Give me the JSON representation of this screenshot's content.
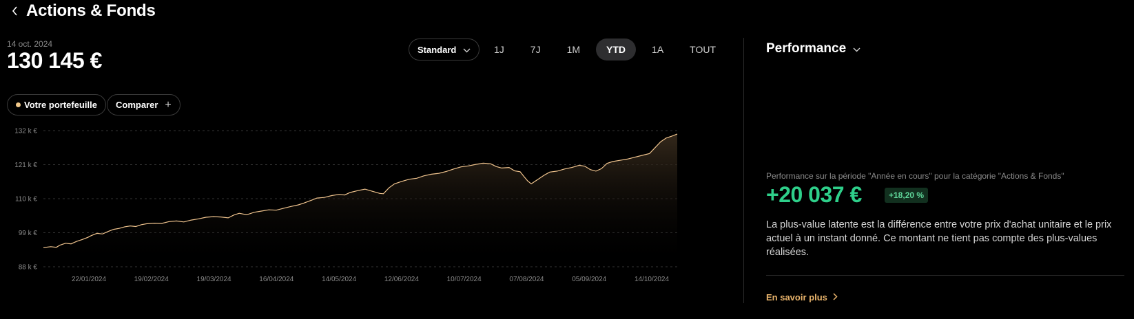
{
  "header": {
    "title": "Actions & Fonds",
    "back_icon": "chevron-left-icon"
  },
  "portfolio": {
    "date": "14 oct. 2024",
    "value": "130 145 €"
  },
  "pills": {
    "portfolio_label": "Votre portefeuille",
    "portfolio_dot_color": "#f2c98a",
    "compare_label": "Comparer",
    "compare_icon": "plus-icon"
  },
  "toolbar": {
    "standard_label": "Standard",
    "ranges": [
      "1J",
      "7J",
      "1M",
      "YTD",
      "1A",
      "TOUT"
    ],
    "active_range": "YTD"
  },
  "chart_data": {
    "type": "area",
    "series_color": "#f0c48e",
    "y_ticks": [
      "132 k €",
      "121 k €",
      "110 k €",
      "99 k €",
      "88 k €"
    ],
    "y_tick_values": [
      132,
      121,
      110,
      99,
      88
    ],
    "x_ticks": [
      "22/01/2024",
      "19/02/2024",
      "19/03/2024",
      "16/04/2024",
      "14/05/2024",
      "12/06/2024",
      "10/07/2024",
      "07/08/2024",
      "05/09/2024",
      "14/10/2024"
    ],
    "ylim": [
      88,
      132
    ],
    "grid": true,
    "points": [
      [
        0,
        94.2
      ],
      [
        4,
        94.5
      ],
      [
        7,
        94.3
      ],
      [
        9,
        95.0
      ],
      [
        12,
        95.6
      ],
      [
        15,
        95.4
      ],
      [
        18,
        96.2
      ],
      [
        21,
        96.8
      ],
      [
        24,
        97.5
      ],
      [
        26,
        98.1
      ],
      [
        29,
        98.8
      ],
      [
        32,
        98.6
      ],
      [
        35,
        99.4
      ],
      [
        38,
        100.1
      ],
      [
        41,
        100.4
      ],
      [
        44,
        100.9
      ],
      [
        47,
        101.2
      ],
      [
        50,
        101.0
      ],
      [
        53,
        101.6
      ],
      [
        56,
        101.9
      ],
      [
        60,
        102.1
      ],
      [
        64,
        102.0
      ],
      [
        68,
        102.6
      ],
      [
        72,
        102.8
      ],
      [
        76,
        102.5
      ],
      [
        80,
        103.1
      ],
      [
        84,
        103.5
      ],
      [
        88,
        104.0
      ],
      [
        92,
        104.2
      ],
      [
        96,
        104.1
      ],
      [
        100,
        103.8
      ],
      [
        103,
        104.7
      ],
      [
        106,
        105.3
      ],
      [
        110,
        104.8
      ],
      [
        114,
        105.6
      ],
      [
        118,
        106.0
      ],
      [
        122,
        106.4
      ],
      [
        126,
        106.3
      ],
      [
        130,
        106.9
      ],
      [
        134,
        107.5
      ],
      [
        138,
        108.0
      ],
      [
        141,
        108.6
      ],
      [
        145,
        109.5
      ],
      [
        148,
        110.2
      ],
      [
        152,
        110.4
      ],
      [
        156,
        111.0
      ],
      [
        160,
        111.4
      ],
      [
        163,
        111.2
      ],
      [
        166,
        112.0
      ],
      [
        170,
        112.6
      ],
      [
        174,
        113.1
      ],
      [
        178,
        112.4
      ],
      [
        182,
        111.7
      ],
      [
        184,
        111.6
      ],
      [
        187,
        113.5
      ],
      [
        190,
        114.8
      ],
      [
        194,
        115.6
      ],
      [
        198,
        116.3
      ],
      [
        202,
        116.6
      ],
      [
        206,
        117.4
      ],
      [
        210,
        117.9
      ],
      [
        214,
        118.2
      ],
      [
        218,
        118.8
      ],
      [
        222,
        119.6
      ],
      [
        226,
        120.3
      ],
      [
        230,
        120.6
      ],
      [
        234,
        121.1
      ],
      [
        238,
        121.5
      ],
      [
        242,
        121.3
      ],
      [
        245,
        120.4
      ],
      [
        248,
        119.9
      ],
      [
        252,
        120.1
      ],
      [
        255,
        119.0
      ],
      [
        258,
        118.7
      ],
      [
        260,
        117.2
      ],
      [
        262,
        115.8
      ],
      [
        264,
        114.8
      ],
      [
        266,
        115.6
      ],
      [
        268,
        116.4
      ],
      [
        271,
        117.6
      ],
      [
        274,
        118.6
      ],
      [
        278,
        118.9
      ],
      [
        282,
        119.6
      ],
      [
        286,
        120.1
      ],
      [
        290,
        120.8
      ],
      [
        293,
        120.5
      ],
      [
        296,
        119.4
      ],
      [
        299,
        118.9
      ],
      [
        302,
        119.7
      ],
      [
        305,
        121.4
      ],
      [
        308,
        122.0
      ],
      [
        312,
        122.4
      ],
      [
        316,
        122.8
      ],
      [
        320,
        123.4
      ],
      [
        324,
        124.0
      ],
      [
        328,
        124.6
      ],
      [
        331,
        126.5
      ],
      [
        334,
        128.4
      ],
      [
        337,
        129.6
      ],
      [
        340,
        130.2
      ],
      [
        343,
        130.9
      ]
    ]
  },
  "performance": {
    "title": "Performance",
    "description": "Performance sur la période \"Année en cours\" pour la catégorie \"Actions & Fonds\"",
    "amount": "+20 037 €",
    "amount_color": "#2ecf8a",
    "percent": "+18,20 %",
    "text": "La plus-value latente est la différence entre votre prix d'achat unitaire et le prix actuel à un instant donné. Ce montant ne tient pas compte des plus-values réalisées.",
    "learn_more": "En savoir plus",
    "accent_color": "#e9b46c"
  }
}
